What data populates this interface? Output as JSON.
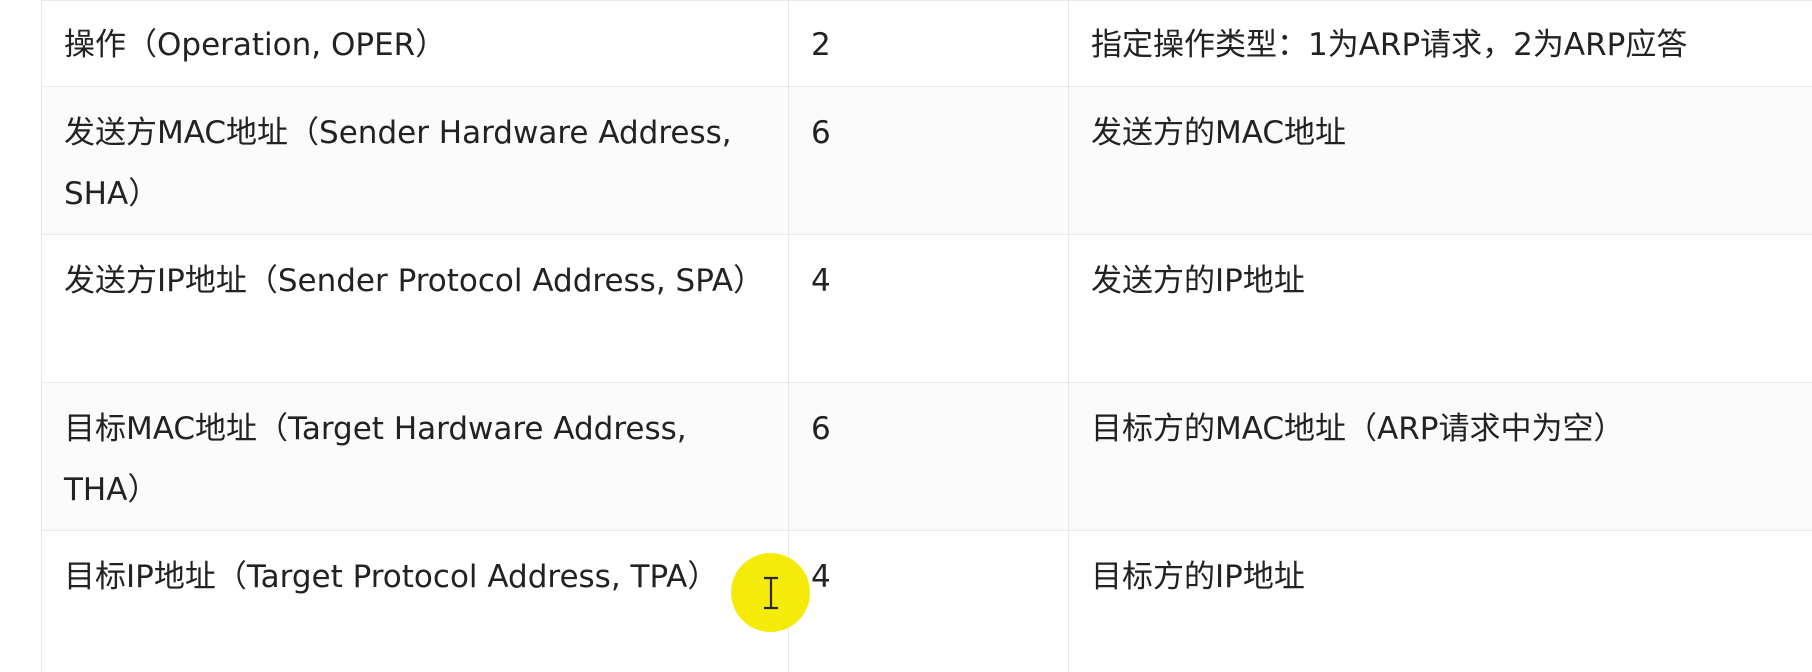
{
  "table": {
    "rows": [
      {
        "field": "操作（Operation, OPER）",
        "size": "2",
        "description": "指定操作类型：1为ARP请求，2为ARP应答"
      },
      {
        "field": "发送方MAC地址（Sender Hardware Address, SHA）",
        "size": "6",
        "description": "发送方的MAC地址"
      },
      {
        "field": "发送方IP地址（Sender Protocol Address, SPA）",
        "size": "4",
        "description": "发送方的IP地址"
      },
      {
        "field": "目标MAC地址（Target Hardware Address, THA）",
        "size": "6",
        "description": "目标方的MAC地址（ARP请求中为空）"
      },
      {
        "field": "目标IP地址（Target Protocol Address, TPA）",
        "size": "4",
        "description": "目标方的IP地址"
      }
    ]
  },
  "cursor": {
    "icon": "text-cursor-icon",
    "highlight_color": "#f5eb00"
  }
}
